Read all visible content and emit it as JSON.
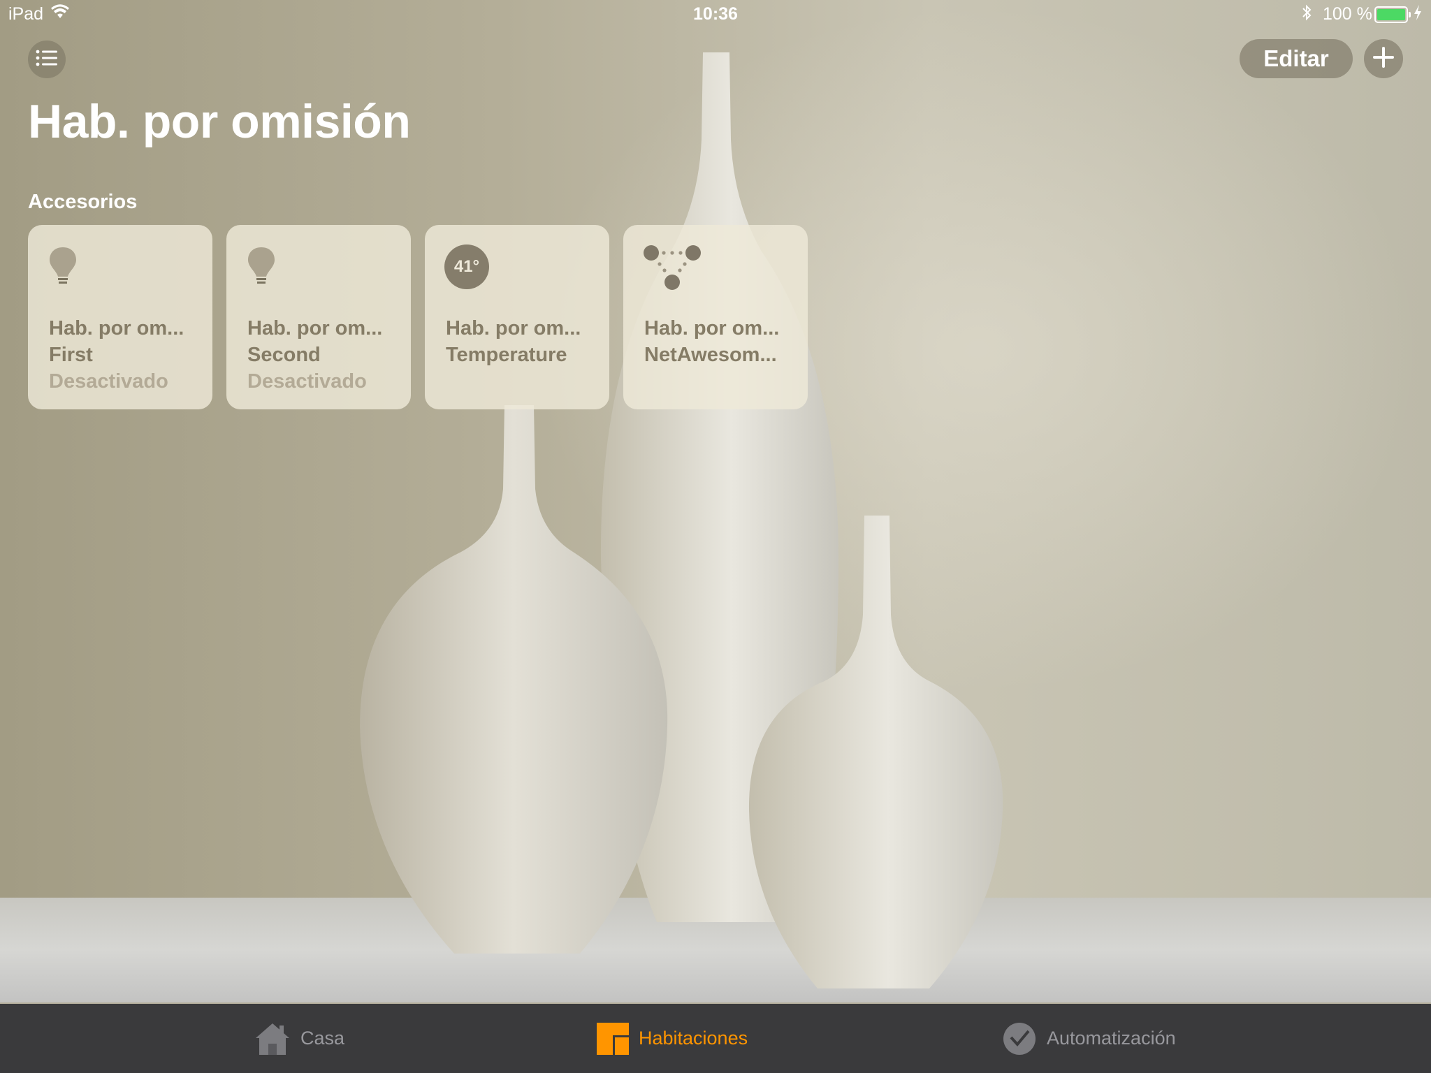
{
  "status_bar": {
    "carrier": "iPad",
    "time": "10:36",
    "battery_percent": "100 %",
    "battery_level": 1.0,
    "battery_color": "#4cd964"
  },
  "toolbar": {
    "menu_icon": "list-icon",
    "edit_label": "Editar",
    "add_icon": "plus-icon"
  },
  "page": {
    "title": "Hab. por omisión",
    "section_label": "Accesorios"
  },
  "accessories": [
    {
      "icon": "lightbulb-icon",
      "room": "Hab. por om...",
      "name": "First",
      "status": "Desactivado"
    },
    {
      "icon": "lightbulb-icon",
      "room": "Hab. por om...",
      "name": "Second",
      "status": "Desactivado"
    },
    {
      "icon": "temperature-icon",
      "value": "41°",
      "room": "Hab. por om...",
      "name": "Temperature",
      "status": ""
    },
    {
      "icon": "bridge-icon",
      "room": "Hab. por om...",
      "name": "NetAwesom...",
      "status": ""
    }
  ],
  "tabbar": {
    "tabs": [
      {
        "label": "Casa",
        "icon": "house-icon",
        "selected": false
      },
      {
        "label": "Habitaciones",
        "icon": "rooms-icon",
        "selected": true
      },
      {
        "label": "Automatización",
        "icon": "automation-icon",
        "selected": false
      }
    ],
    "active_color": "#ff9500"
  }
}
